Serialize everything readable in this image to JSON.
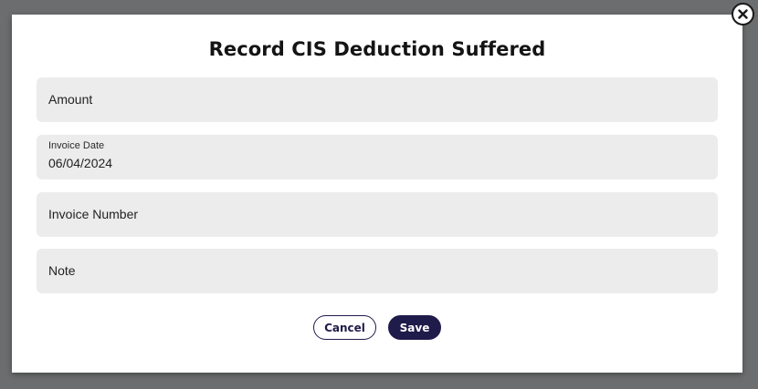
{
  "dialog": {
    "title": "Record CIS Deduction Suffered",
    "close_icon": "close-icon"
  },
  "fields": {
    "amount": {
      "label": "Amount",
      "value": ""
    },
    "invoice_date": {
      "label": "Invoice Date",
      "value": "06/04/2024"
    },
    "invoice_number": {
      "label": "Invoice Number",
      "value": ""
    },
    "note": {
      "label": "Note",
      "value": ""
    }
  },
  "actions": {
    "cancel_label": "Cancel",
    "save_label": "Save"
  },
  "colors": {
    "backdrop": "#6b6d6e",
    "field_background": "#ececec",
    "primary": "#1f1b4a"
  }
}
